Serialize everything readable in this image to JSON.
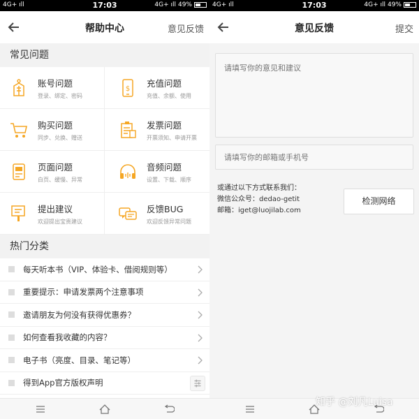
{
  "left": {
    "status": {
      "network": "4G+ ıll",
      "time": "17:03",
      "signal": "4G+ ıll",
      "battery": "49%"
    },
    "nav": {
      "title": "帮助中心",
      "action": "意见反馈"
    },
    "faq": {
      "title": "常见问题",
      "items": [
        {
          "title": "账号问题",
          "subtitle": "登录、绑定、密码",
          "icon": "account-icon"
        },
        {
          "title": "充值问题",
          "subtitle": "充值、余额、使用",
          "icon": "recharge-icon"
        },
        {
          "title": "购买问题",
          "subtitle": "同步、兑换、赠送",
          "icon": "cart-icon"
        },
        {
          "title": "发票问题",
          "subtitle": "开票须知、申请开票",
          "icon": "invoice-icon"
        },
        {
          "title": "页面问题",
          "subtitle": "白页、缓慢、异常",
          "icon": "page-icon"
        },
        {
          "title": "音频问题",
          "subtitle": "设置、下载、顺序",
          "icon": "headphone-icon"
        },
        {
          "title": "提出建议",
          "subtitle": "欢迎提出宝贵建议",
          "icon": "suggestion-icon"
        },
        {
          "title": "反馈BUG",
          "subtitle": "欢迎反馈异常问题",
          "icon": "bug-icon"
        }
      ]
    },
    "hot": {
      "title": "热门分类",
      "items": [
        {
          "text": "每天听本书（VIP、体验卡、借阅规则等）"
        },
        {
          "text": "重要提示：申请发票两个注意事项"
        },
        {
          "text": "邀请朋友为何没有获得优惠券？"
        },
        {
          "text": "如何查看我收藏的内容？"
        },
        {
          "text": "电子书（亮度、目录、笔记等）"
        },
        {
          "text": "得到App官方版权声明"
        }
      ]
    }
  },
  "right": {
    "status": {
      "network": "4G+ ıll",
      "time": "17:03",
      "signal": "4G+ ıll",
      "battery": "49%"
    },
    "nav": {
      "title": "意见反馈",
      "action": "提交"
    },
    "feedback_placeholder": "请填写你的意见和建议",
    "contact_placeholder": "请填写你的邮箱或手机号",
    "contact": {
      "intro": "或通过以下方式联系我们：",
      "wechat": "微信公众号：dedao-getit",
      "email": "邮箱：iget@luojilab.com"
    },
    "detect_button": "检测网络",
    "watermark": "知乎 @刘凡Luisa"
  },
  "colors": {
    "accent": "#f5a623",
    "text": "#333333",
    "muted": "#999999",
    "section_bg": "#f2f2f2"
  }
}
